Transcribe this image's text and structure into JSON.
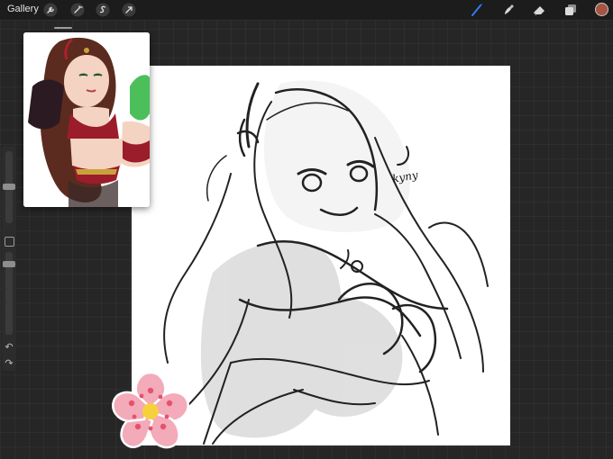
{
  "topbar": {
    "gallery_label": "Gallery",
    "tools_left": [
      "wrench-icon",
      "magic-wand-icon",
      "selection-icon",
      "transform-arrow-icon"
    ],
    "tools_right": [
      "brush-icon",
      "smudge-icon",
      "eraser-icon",
      "layers-icon"
    ],
    "active_tool": "brush-icon",
    "active_tool_color": "#2f7cf6",
    "current_color": "#a55442"
  },
  "sidebar": {
    "brush_size_slider": "brush-size-slider",
    "opacity_slider": "opacity-slider",
    "undo_icon": "↶",
    "redo_icon": "↷"
  },
  "canvas": {
    "signature": "kyny"
  },
  "reference": {
    "title": ""
  },
  "colors": {
    "ui_background": "#262626",
    "toolbar_background": "#1c1c1c",
    "canvas_background": "#ffffff",
    "flower_pink": "#f3aab9",
    "flower_center": "#f7d13c"
  }
}
